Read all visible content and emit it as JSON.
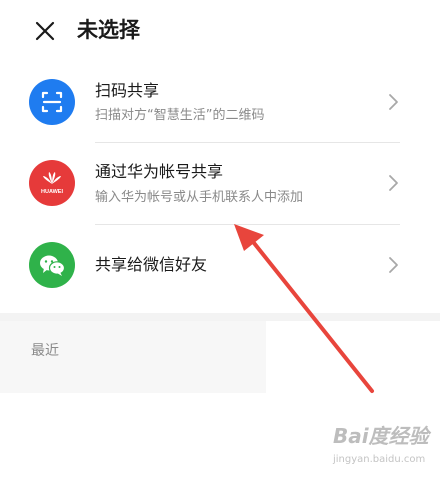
{
  "header": {
    "close_icon": "close-icon",
    "title": "未选择"
  },
  "share_options": [
    {
      "label": "扫码共享",
      "subtitle": "扫描对方“智慧生活”的二维码",
      "icon": "scan-qr-icon",
      "icon_color": "#1f7cf0"
    },
    {
      "label": "通过华为帐号共享",
      "subtitle": "输入华为帐号或从手机联系人中添加",
      "icon": "huawei-logo-icon",
      "icon_color": "#e63a3a",
      "icon_text": "HUAWEI"
    },
    {
      "label": "共享给微信好友",
      "icon": "wechat-icon",
      "icon_color": "#2fb24a"
    }
  ],
  "recent": {
    "label": "最近"
  },
  "annotation_color": "#e8453c",
  "watermark": {
    "logo": "Bai度经验",
    "url": "jingyan.baidu.com"
  }
}
